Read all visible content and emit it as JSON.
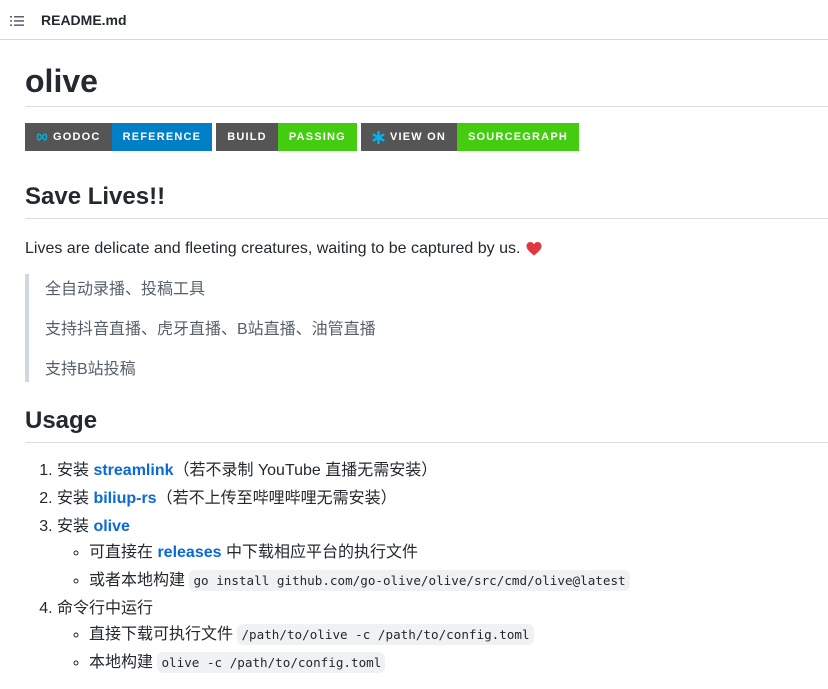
{
  "header": {
    "file_name": "README.md",
    "icon": "list-icon"
  },
  "title": "olive",
  "badges": [
    {
      "left": "GODOC",
      "right": "REFERENCE",
      "right_color": "#007ec6",
      "icon": "infinity-icon"
    },
    {
      "left": "BUILD",
      "right": "PASSING",
      "right_color": "#44cc11"
    },
    {
      "left": "VIEW ON",
      "right": "SOURCEGRAPH",
      "right_color": "#44cc11",
      "icon": "asterisk-icon"
    }
  ],
  "save_lives": {
    "heading": "Save Lives!!",
    "intro": "Lives are delicate and fleeting creatures, waiting to be captured by us.",
    "quote": [
      "全自动录播、投稿工具",
      "支持抖音直播、虎牙直播、B站直播、油管直播",
      "支持B站投稿"
    ]
  },
  "usage": {
    "heading": "Usage",
    "steps": [
      {
        "prefix": "安装 ",
        "link": "streamlink",
        "suffix": "（若不录制 YouTube 直播无需安装）"
      },
      {
        "prefix": "安装 ",
        "link": "biliup-rs",
        "suffix": "（若不上传至哔哩哔哩无需安装）"
      },
      {
        "prefix": "安装 ",
        "link": "olive",
        "suffix": "",
        "sub": [
          {
            "prefix": "可直接在 ",
            "link": "releases",
            "suffix": " 中下载相应平台的执行文件"
          },
          {
            "prefix": "或者本地构建 ",
            "code": "go install github.com/go-olive/olive/src/cmd/olive@latest"
          }
        ]
      },
      {
        "prefix": "命令行中运行",
        "link": "",
        "suffix": "",
        "sub": [
          {
            "prefix": "直接下载可执行文件 ",
            "code": "/path/to/olive -c /path/to/config.toml"
          },
          {
            "prefix": "本地构建 ",
            "code": "olive -c /path/to/config.toml"
          }
        ]
      }
    ]
  },
  "colors": {
    "link": "#0969da",
    "heart": "#e0383e"
  }
}
